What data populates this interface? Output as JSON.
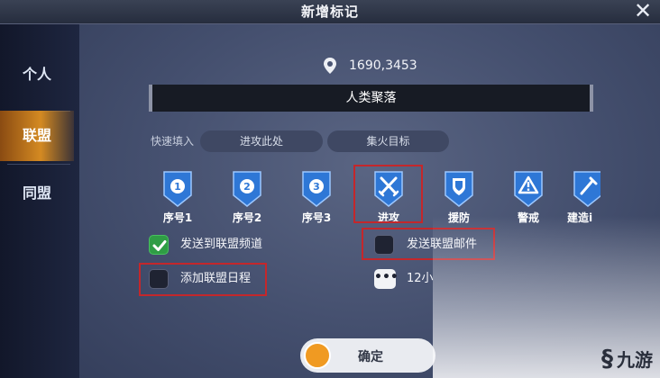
{
  "dialog": {
    "title": "新增标记",
    "close": "✕"
  },
  "sidebar": {
    "items": [
      {
        "label": "个人",
        "active": false
      },
      {
        "label": "联盟",
        "active": true
      },
      {
        "label": "同盟",
        "active": false
      }
    ]
  },
  "location": {
    "coords": "1690,3453",
    "icon": "location-pin-icon"
  },
  "marker_name": "人类聚落",
  "quick_fill": {
    "label": "快速填入",
    "buttons": [
      "进攻此处",
      "集火目标"
    ]
  },
  "markers": [
    {
      "label": "序号1",
      "glyph": "1",
      "icon": "number-1-icon"
    },
    {
      "label": "序号2",
      "glyph": "2",
      "icon": "number-2-icon"
    },
    {
      "label": "序号3",
      "glyph": "3",
      "icon": "number-3-icon"
    },
    {
      "label": "进攻",
      "glyph": "⚔",
      "icon": "crossed-swords-icon",
      "selected": true
    },
    {
      "label": "援防",
      "glyph": "🛡",
      "icon": "shield-icon"
    },
    {
      "label": "警戒",
      "glyph": "⚠",
      "icon": "warning-icon"
    },
    {
      "label": "建造i",
      "glyph": "⚒",
      "icon": "build-icon"
    }
  ],
  "options": {
    "send_channel": {
      "label": "发送到联盟频道",
      "checked": true
    },
    "send_mail": {
      "label": "发送联盟邮件",
      "checked": false
    },
    "add_schedule": {
      "label": "添加联盟日程",
      "checked": false
    },
    "duration": {
      "label": "12小",
      "icon": "more-dots-icon",
      "glyph": "•••"
    }
  },
  "confirm": {
    "label": "确定"
  },
  "watermark": {
    "symbol": "§",
    "text": "九游"
  },
  "colors": {
    "accent": "#d48a22",
    "highlight": "#c4272b",
    "marker_blue": "#2e77d6",
    "check_green": "#2f9d45"
  }
}
